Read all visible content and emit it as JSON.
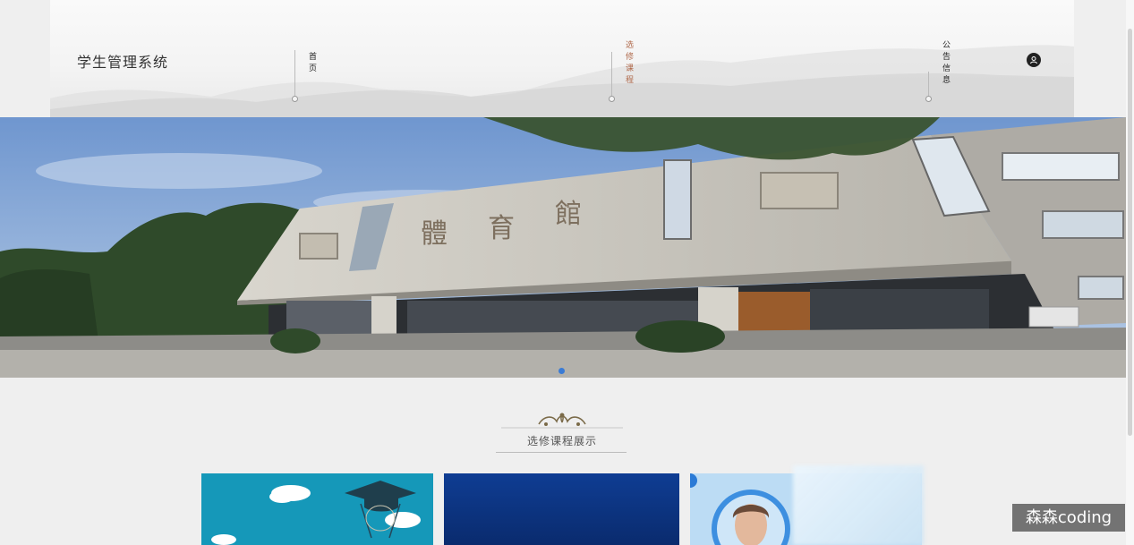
{
  "site": {
    "title": "学生管理系统"
  },
  "nav": [
    {
      "label": "首页",
      "active": false
    },
    {
      "label": "选修课程",
      "active": true
    },
    {
      "label": "公告信息",
      "active": false
    }
  ],
  "icons": {
    "user": "user-icon"
  },
  "banner": {
    "alt": "building-photo",
    "sign_text": "體育館"
  },
  "section": {
    "title": "选修课程展示"
  },
  "cards": [
    {
      "name": "course-card-1",
      "theme": "graduation-cap"
    },
    {
      "name": "course-card-2",
      "theme": "dark-blue"
    },
    {
      "name": "course-card-3",
      "theme": "person-portrait"
    }
  ],
  "watermark": "森森coding",
  "colors": {
    "accent": "#b06a4c",
    "dot": "#3a7bd5"
  }
}
